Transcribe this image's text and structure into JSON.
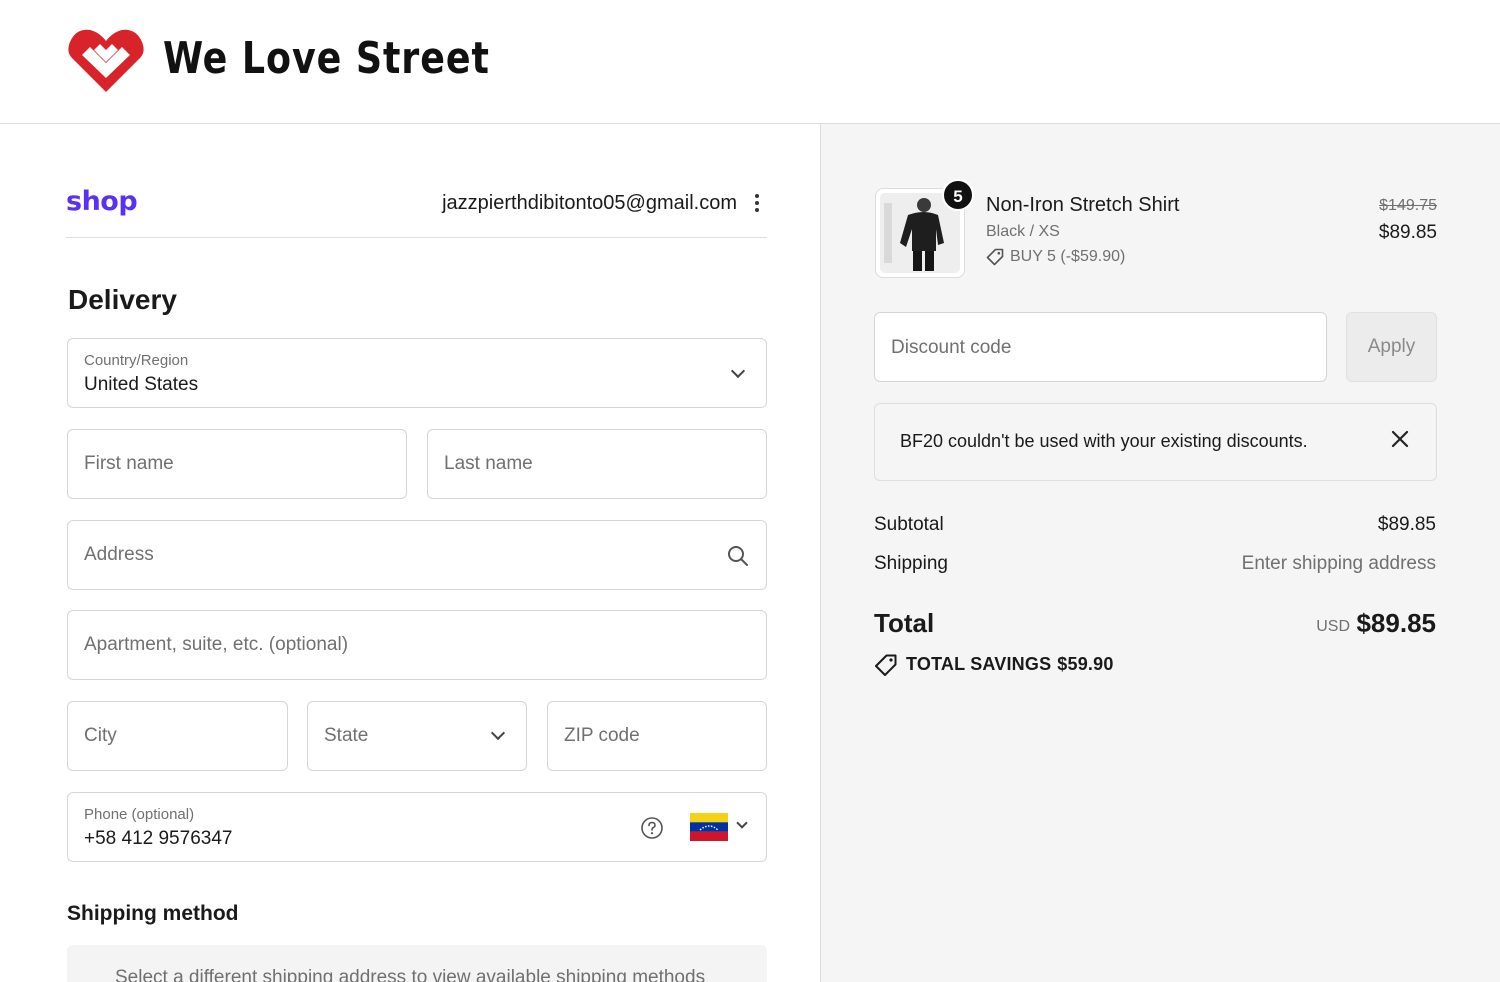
{
  "brand": {
    "name": "We Love Street",
    "accent_color": "#d8232a"
  },
  "shop_pay": {
    "logo_text": "shop",
    "logo_color": "#5a31f4",
    "email": "jazzpierthdibitonto05@gmail.com"
  },
  "delivery": {
    "title": "Delivery",
    "country_label": "Country/Region",
    "country_value": "United States",
    "first_name_placeholder": "First name",
    "last_name_placeholder": "Last name",
    "address_placeholder": "Address",
    "apartment_placeholder": "Apartment, suite, etc. (optional)",
    "city_placeholder": "City",
    "state_placeholder": "State",
    "zip_placeholder": "ZIP code",
    "phone_label": "Phone (optional)",
    "phone_value": "+58 412 9576347",
    "phone_flag": "venezuela-flag"
  },
  "shipping_method": {
    "title": "Shipping method",
    "message": "Select a different shipping address to view available shipping methods"
  },
  "cart": {
    "item": {
      "quantity": "5",
      "name": "Non-Iron Stretch Shirt",
      "variant": "Black / XS",
      "discount": "BUY 5 (-$59.90)",
      "original_price": "$149.75",
      "price": "$89.85"
    },
    "discount_placeholder": "Discount code",
    "apply_label": "Apply",
    "alert_message": "BF20 couldn't be used with your existing discounts.",
    "subtotal_label": "Subtotal",
    "subtotal_value": "$89.85",
    "shipping_label": "Shipping",
    "shipping_value": "Enter shipping address",
    "total_label": "Total",
    "currency": "USD",
    "total_value": "$89.85",
    "savings_label": "TOTAL SAVINGS",
    "savings_value": "$59.90"
  }
}
